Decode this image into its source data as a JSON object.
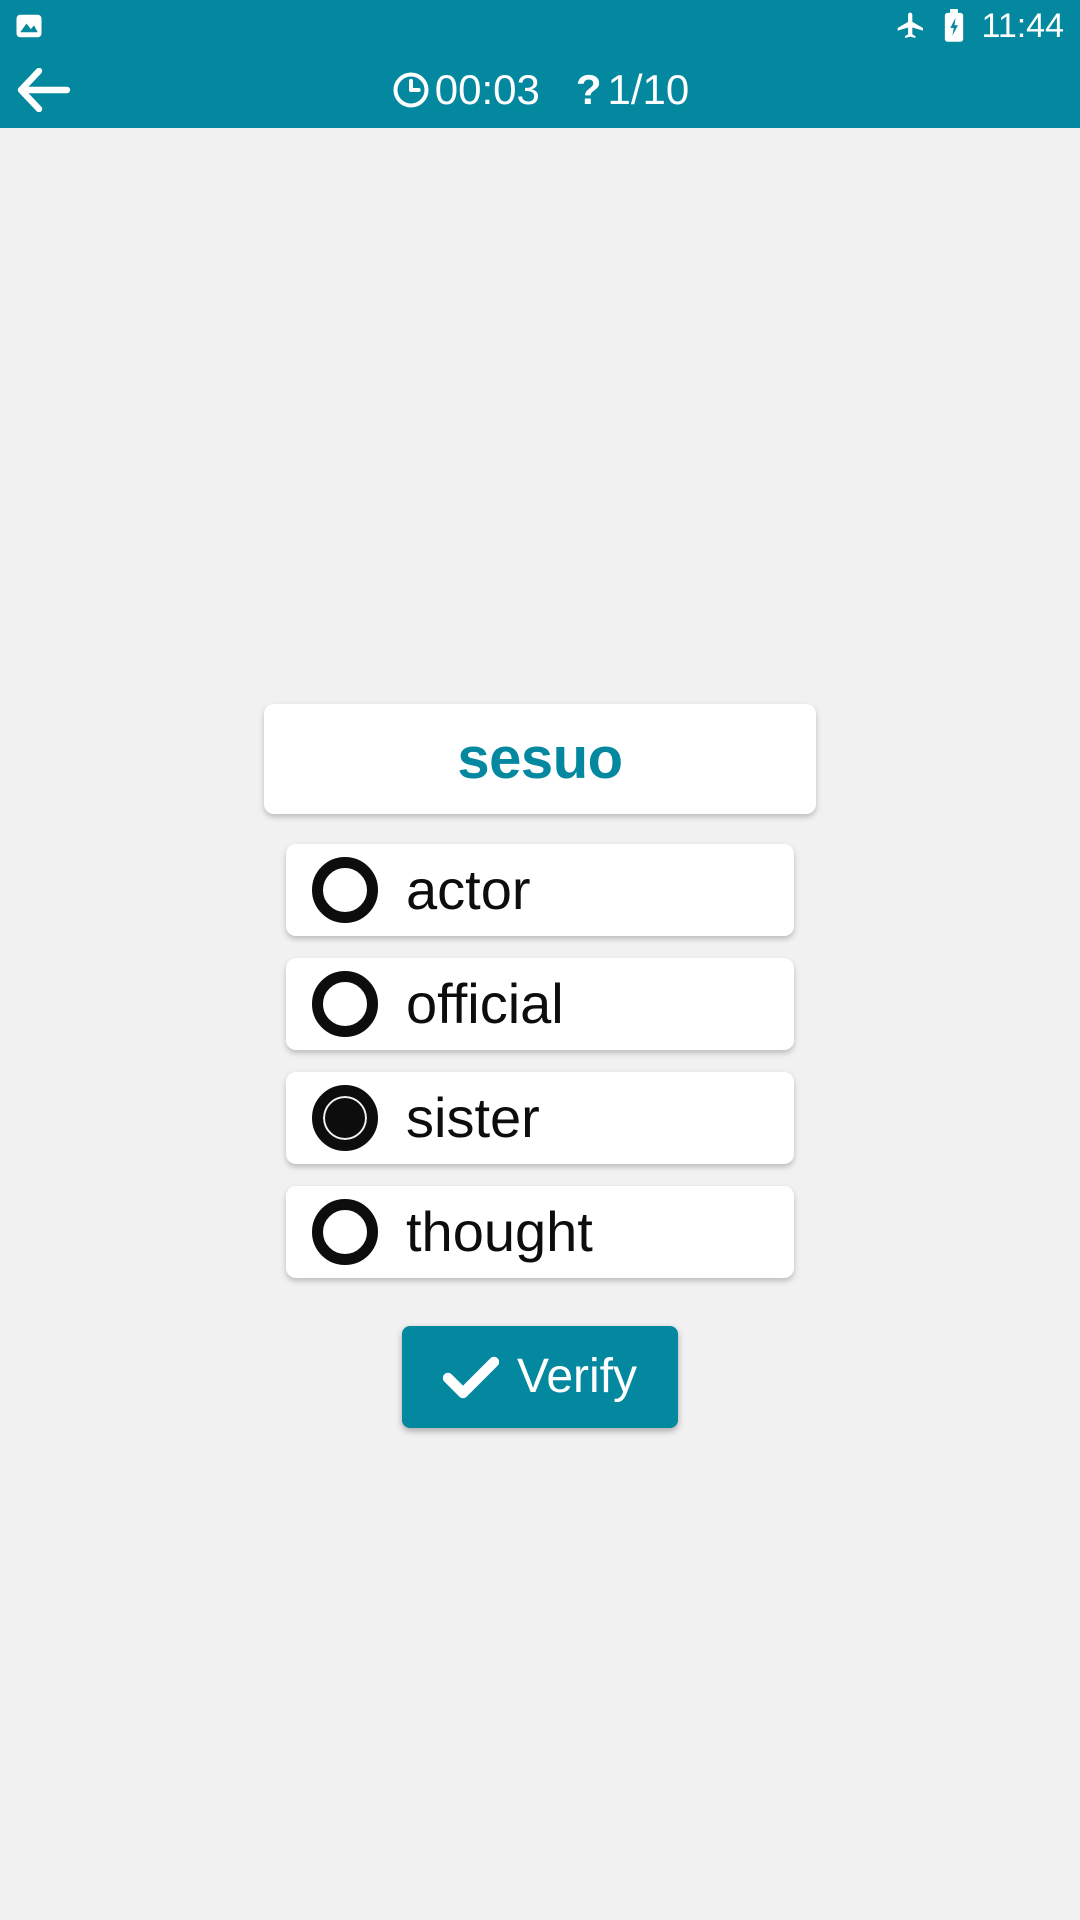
{
  "status_bar": {
    "left_icons": [
      {
        "name": "image-notification-icon",
        "glyph": "image"
      }
    ],
    "right_icons": [
      {
        "name": "airplane-mode-icon",
        "glyph": "airplane"
      },
      {
        "name": "battery-charging-icon",
        "glyph": "battery-bolt"
      }
    ],
    "time": "11:44"
  },
  "app_bar": {
    "back_label": "Back",
    "timer_icon": "clock-icon",
    "timer_value": "00:03",
    "question_icon": "question-mark-icon",
    "question_counter": "1/10"
  },
  "quiz": {
    "word": "sesuo",
    "options": [
      {
        "label": "actor",
        "selected": false
      },
      {
        "label": "official",
        "selected": false
      },
      {
        "label": "sister",
        "selected": true
      },
      {
        "label": "thought",
        "selected": false
      }
    ],
    "verify_label": "Verify",
    "verify_icon": "check-icon"
  },
  "colors": {
    "accent": "#04889f",
    "background": "#f1f1f1",
    "card": "#ffffff",
    "radio": "#0d0d0d",
    "word_text": "#04889f"
  }
}
